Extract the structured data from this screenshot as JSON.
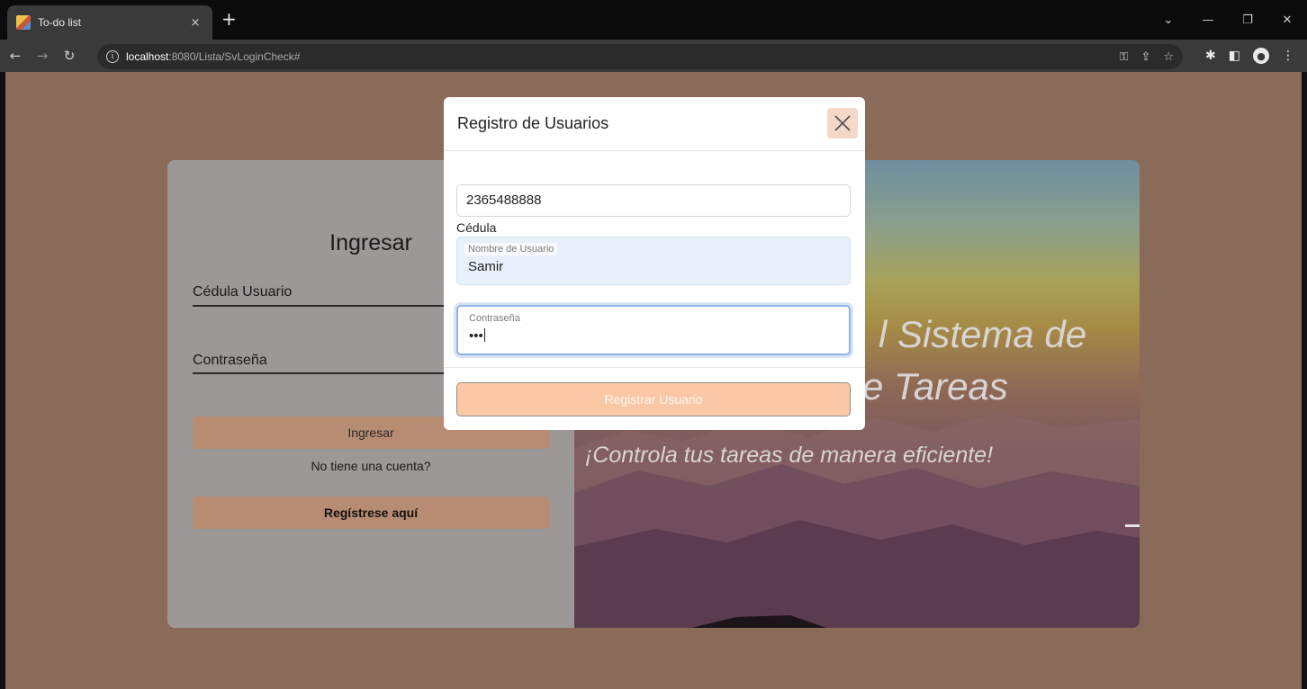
{
  "browser": {
    "tab_title": "To-do list",
    "tab_close": "×",
    "new_tab": "+",
    "url_host": "localhost",
    "url_path": ":8080/Lista/SvLoginCheck#",
    "window_controls": {
      "minimize": "—",
      "maximize": "❐",
      "close": "✕",
      "dropdown": "⌄"
    }
  },
  "login": {
    "title": "Ingresar",
    "id_label": "Cédula Usuario",
    "password_label": "Contraseña",
    "login_button": "Ingresar",
    "no_account_text": "No tiene una cuenta?",
    "register_button": "Regístrese aquí"
  },
  "hero": {
    "line1_fragment": "l Sistema de",
    "line2_fragment": "e Tareas",
    "tagline": "¡Controla tus tareas de manera eficiente!"
  },
  "modal": {
    "title": "Registro de Usuarios",
    "id_value": "2365488888",
    "id_label": "Cédula",
    "username_label": "Nombre de Usuario",
    "username_value": "Samir",
    "password_label": "Contraseña",
    "password_value": "•••",
    "submit_button": "Registrar Usuario"
  },
  "colors": {
    "page_background": "#8a6a58",
    "accent_button": "#fbc8a6",
    "close_button_bg": "#f6d8c8",
    "focus_ring": "#8eb3e6",
    "autofill_bg": "#e8f0fc"
  }
}
